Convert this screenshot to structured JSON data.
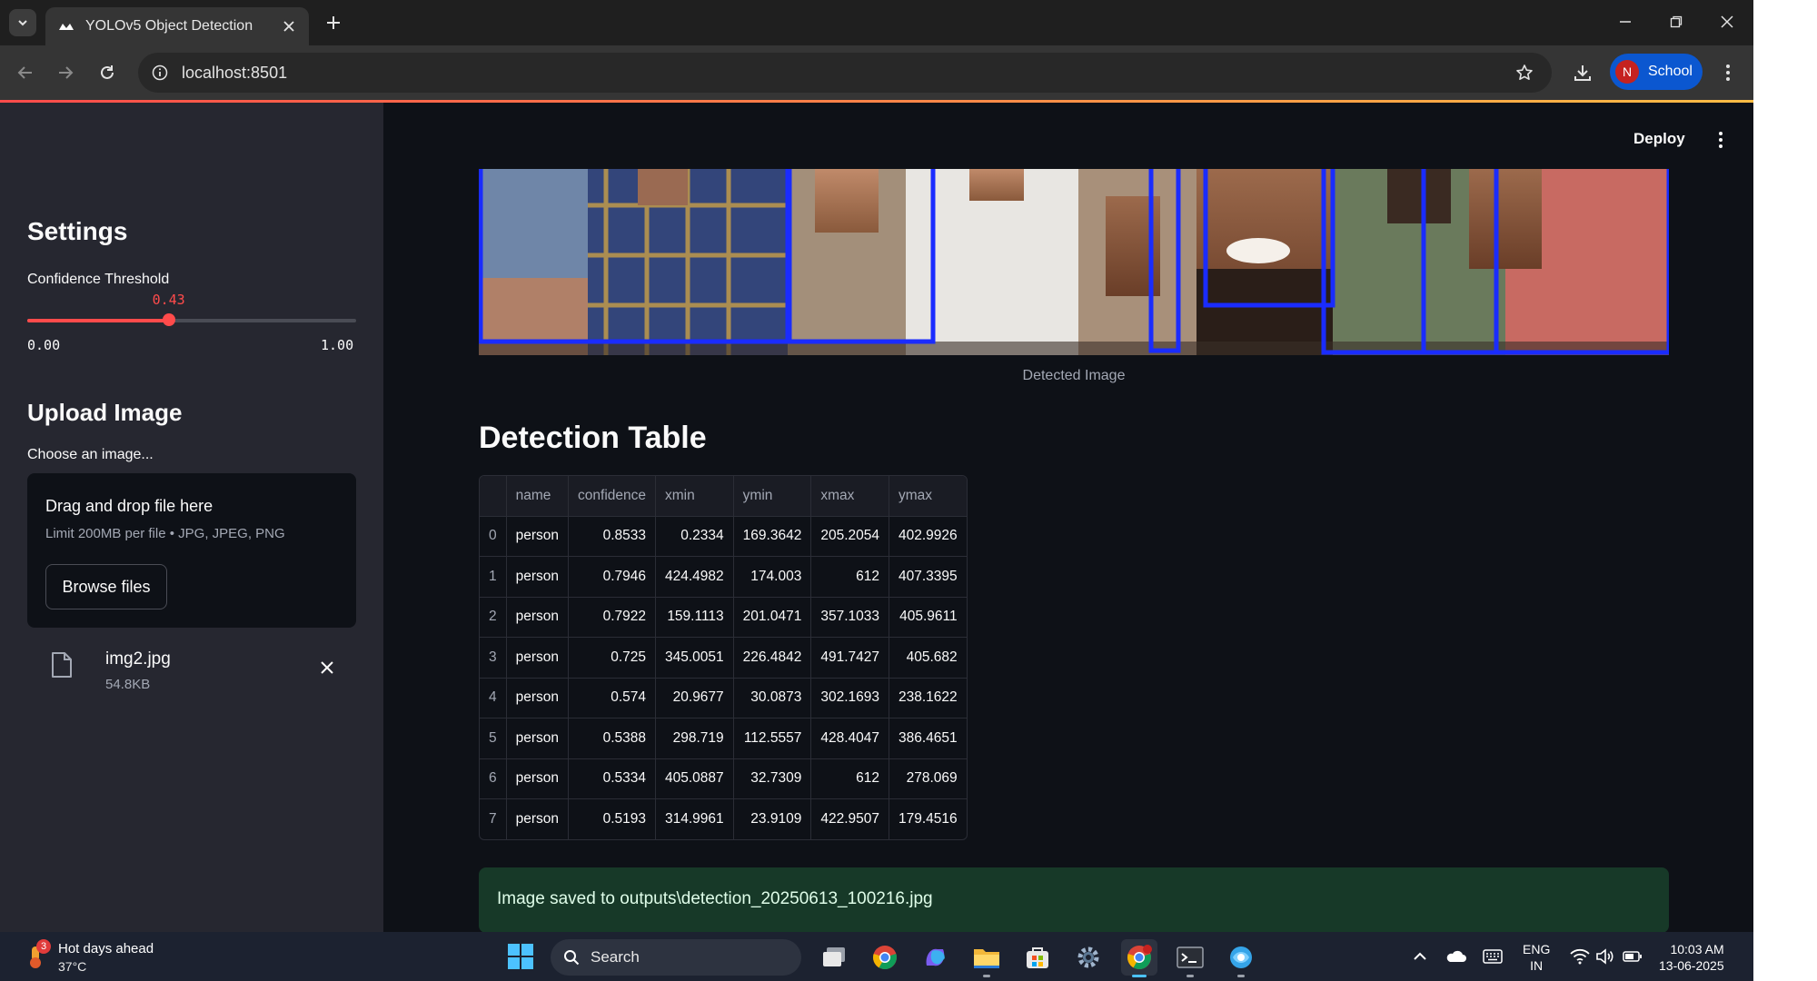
{
  "browser": {
    "tab_title": "YOLOv5 Object Detection",
    "url": "localhost:8501",
    "profile_initial": "N",
    "profile_name": "School"
  },
  "sidebar": {
    "settings_heading": "Settings",
    "confidence_label": "Confidence Threshold",
    "confidence_value": "0.43",
    "confidence_fraction": 0.43,
    "slider_min": "0.00",
    "slider_max": "1.00",
    "upload_heading": "Upload Image",
    "choose_label": "Choose an image...",
    "dropzone_title": "Drag and drop file here",
    "dropzone_limit": "Limit 200MB per file • JPG, JPEG, PNG",
    "browse_label": "Browse files",
    "uploaded_file": {
      "name": "img2.jpg",
      "size": "54.8KB"
    }
  },
  "main": {
    "deploy_label": "Deploy",
    "image_caption": "Detected Image",
    "table_title": "Detection Table",
    "success_message": "Image saved to outputs\\detection_20250613_100216.jpg"
  },
  "table": {
    "columns": [
      "",
      "name",
      "confidence",
      "xmin",
      "ymin",
      "xmax",
      "ymax"
    ],
    "rows": [
      [
        "0",
        "person",
        "0.8533",
        "0.2334",
        "169.3642",
        "205.2054",
        "402.9926"
      ],
      [
        "1",
        "person",
        "0.7946",
        "424.4982",
        "174.003",
        "612",
        "407.3395"
      ],
      [
        "2",
        "person",
        "0.7922",
        "159.1113",
        "201.0471",
        "357.1033",
        "405.9611"
      ],
      [
        "3",
        "person",
        "0.725",
        "345.0051",
        "226.4842",
        "491.7427",
        "405.682"
      ],
      [
        "4",
        "person",
        "0.574",
        "20.9677",
        "30.0873",
        "302.1693",
        "238.1622"
      ],
      [
        "5",
        "person",
        "0.5388",
        "298.719",
        "112.5557",
        "428.4047",
        "386.4651"
      ],
      [
        "6",
        "person",
        "0.5334",
        "405.0887",
        "32.7309",
        "612",
        "278.069"
      ],
      [
        "7",
        "person",
        "0.5193",
        "314.9961",
        "23.9109",
        "422.9507",
        "179.4516"
      ]
    ]
  },
  "taskbar": {
    "weather_title": "Hot days ahead",
    "weather_temp": "37°C",
    "weather_badge": "3",
    "search_placeholder": "Search",
    "lang_line1": "ENG",
    "lang_line2": "IN",
    "time": "10:03 AM",
    "date": "13-06-2025"
  },
  "colors": {
    "accent": "#ff4b4b",
    "box_color": "#1a2cff",
    "success_bg": "#173928",
    "sidebar_bg": "#262730",
    "main_bg": "#0e1117"
  }
}
